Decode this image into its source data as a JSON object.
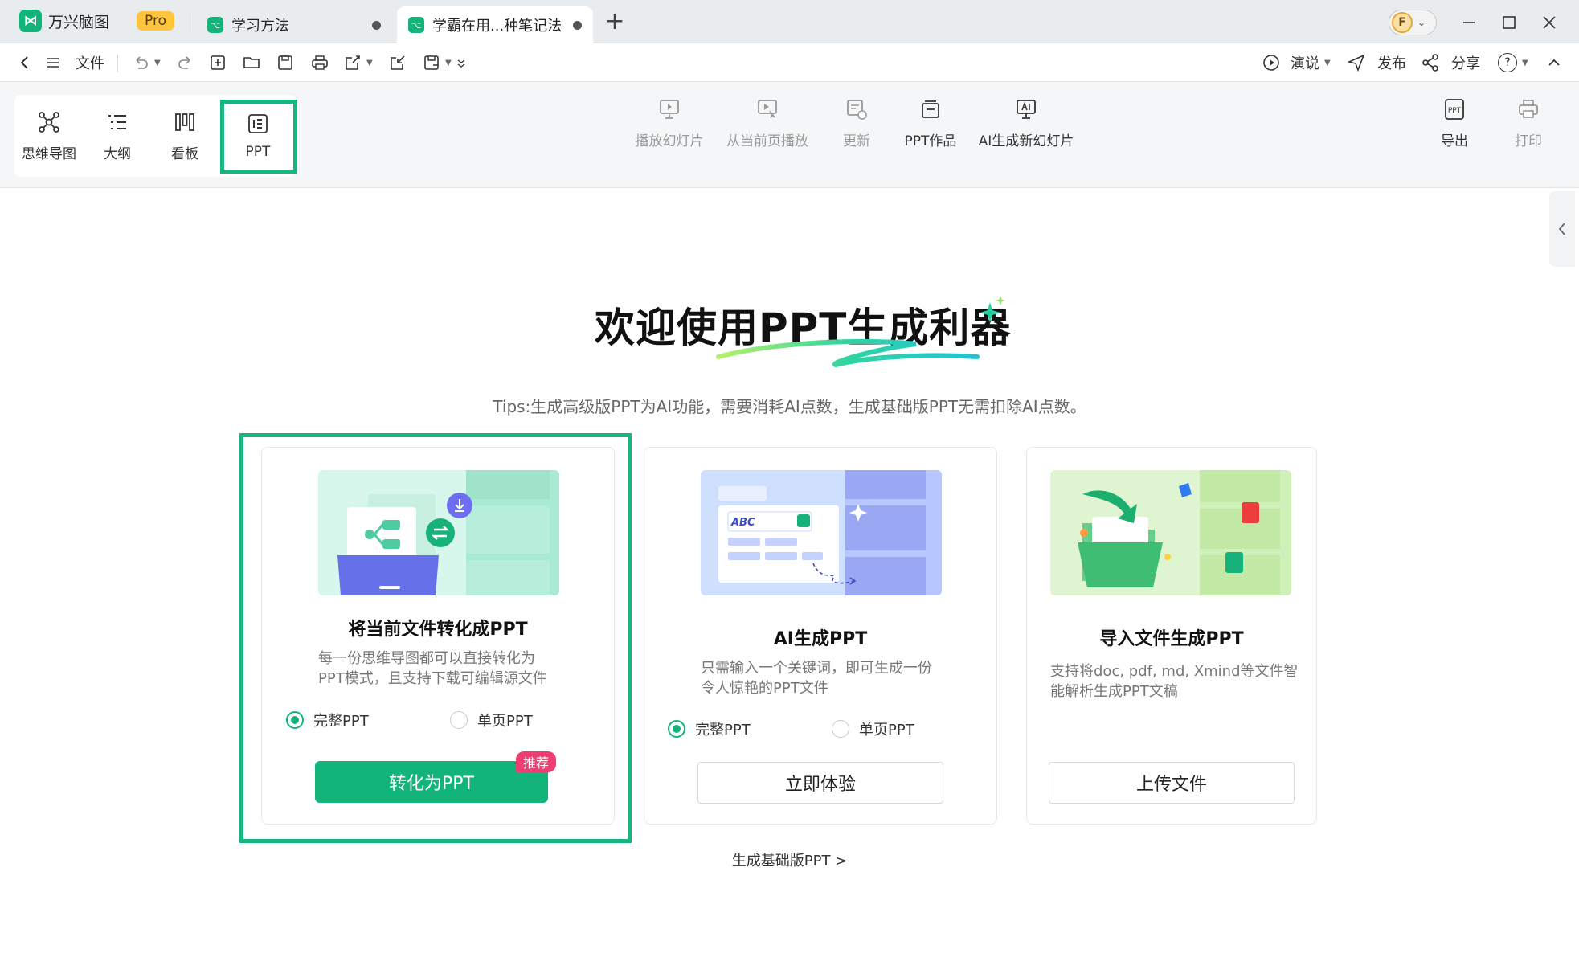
{
  "titlebar": {
    "app_name": "万兴脑图",
    "pro_label": "Pro",
    "tabs": [
      {
        "label": "学习方法"
      },
      {
        "label": "学霸在用...种笔记法"
      }
    ],
    "new_tab": "+",
    "avatar_initial": "F"
  },
  "menubar": {
    "file_label": "文件",
    "present_label": "演说",
    "publish_label": "发布",
    "share_label": "分享",
    "help_label": "?"
  },
  "ribbon": {
    "views": [
      {
        "label": "思维导图"
      },
      {
        "label": "大纲"
      },
      {
        "label": "看板"
      },
      {
        "label": "PPT"
      }
    ],
    "actions": [
      {
        "label": "播放幻灯片"
      },
      {
        "label": "从当前页播放"
      },
      {
        "label": "更新"
      },
      {
        "label": "PPT作品"
      },
      {
        "label": "AI生成新幻灯片"
      }
    ],
    "export_label": "导出",
    "print_label": "打印"
  },
  "main": {
    "title": "欢迎使用PPT生成利器",
    "tips": "Tips:生成高级版PPT为AI功能，需要消耗AI点数，生成基础版PPT无需扣除AI点数。",
    "cards": [
      {
        "title": "将当前文件转化成PPT",
        "desc_line1": "每一份思维导图都可以直接转化为",
        "desc_line2": "PPT模式，且支持下载可编辑源文件",
        "option_full": "完整PPT",
        "option_single": "单页PPT",
        "button": "转化为PPT",
        "badge": "推荐"
      },
      {
        "title": "AI生成PPT",
        "desc_line1": "只需输入一个关键词，即可生成一份",
        "desc_line2": "令人惊艳的PPT文件",
        "illus_text": "ABC",
        "option_full": "完整PPT",
        "option_single": "单页PPT",
        "button": "立即体验"
      },
      {
        "title": "导入文件生成PPT",
        "desc_line1": "支持将doc, pdf, md, Xmind等文件智",
        "desc_line2": "能解析生成PPT文稿",
        "button": "上传文件"
      }
    ],
    "basic_link": "生成基础版PPT >"
  },
  "colors": {
    "accent": "#13b47a",
    "highlight": "#16b67e",
    "badge": "#ee3d73",
    "pro": "#ffc53d"
  }
}
